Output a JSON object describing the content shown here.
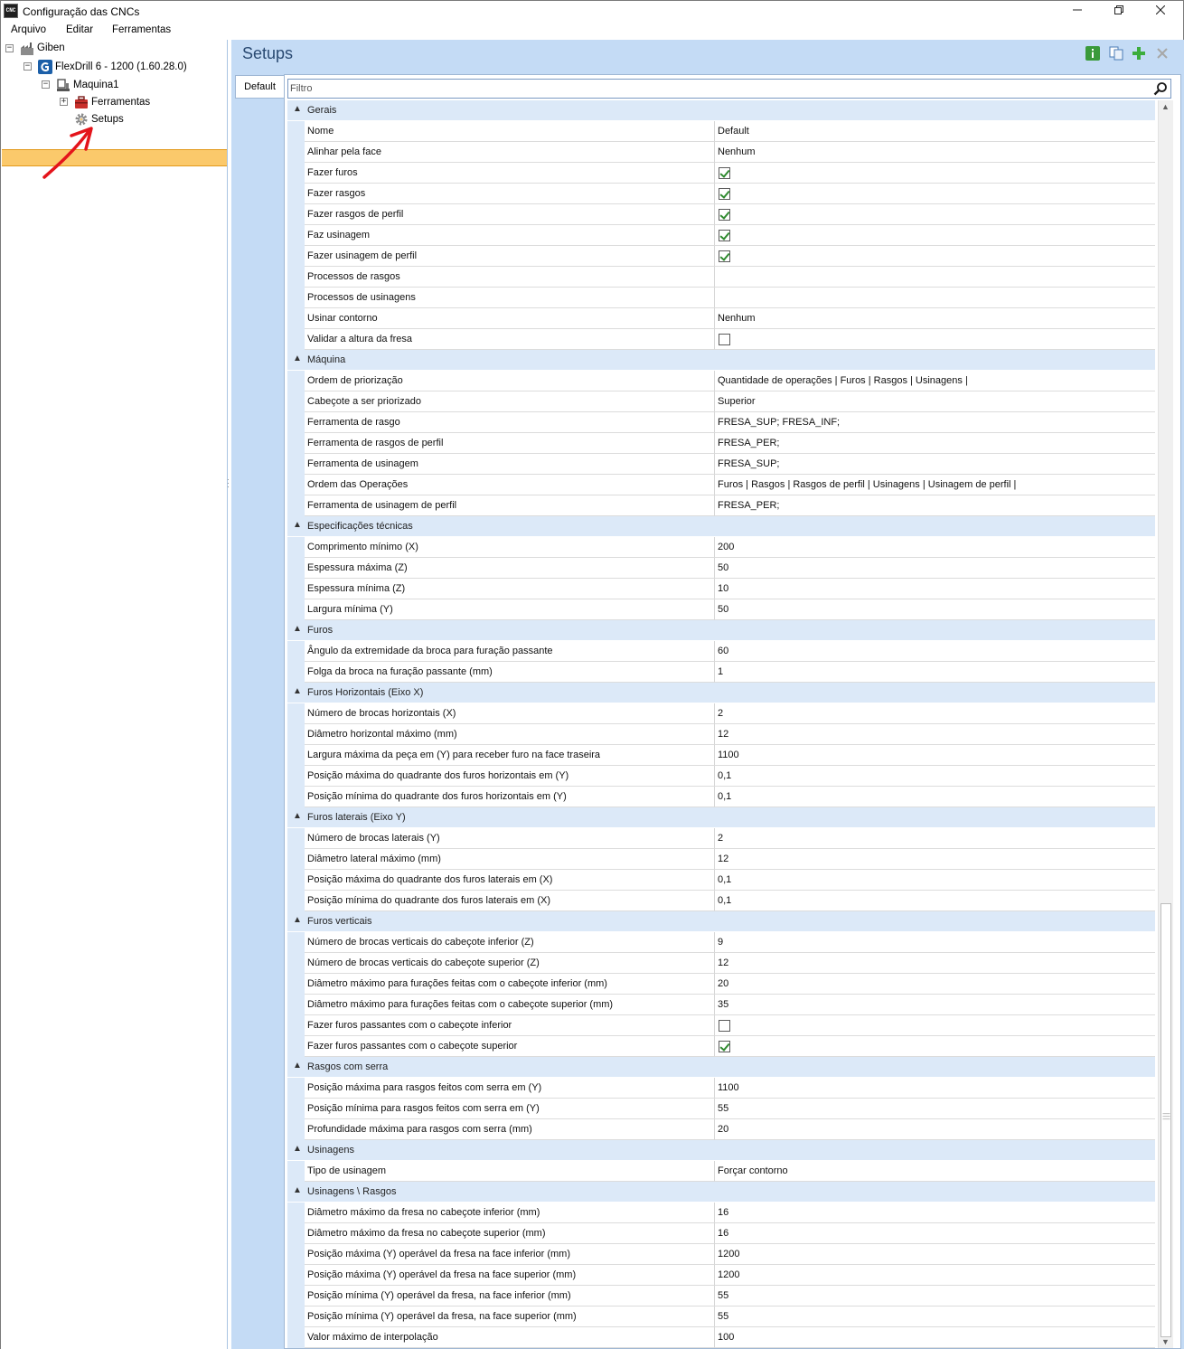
{
  "window": {
    "title": "Configuração das CNCs",
    "app_icon": "CNC"
  },
  "menu": [
    "Arquivo",
    "Editar",
    "Ferramentas"
  ],
  "tree": {
    "root": "Giben",
    "machine_model": "FlexDrill 6 - 1200 (1.60.28.0)",
    "machine": "Maquina1",
    "tools": "Ferramentas",
    "setups": "Setups"
  },
  "panel": {
    "title": "Setups",
    "tab": "Default",
    "filter_placeholder": "Filtro"
  },
  "colors": {
    "accent": "#2a4a72",
    "selection": "#fbc96b",
    "panel_bg": "#c4dbf5",
    "category_bg": "#dce9f8"
  },
  "grid": {
    "categories": [
      {
        "name": "Gerais",
        "rows": [
          {
            "name": "Nome",
            "value": "Default"
          },
          {
            "name": "Alinhar pela face",
            "value": "Nenhum"
          },
          {
            "name": "Fazer furos",
            "check": true
          },
          {
            "name": "Fazer rasgos",
            "check": true
          },
          {
            "name": "Fazer rasgos de perfil",
            "check": true
          },
          {
            "name": "Faz usinagem",
            "check": true
          },
          {
            "name": "Fazer usinagem de perfil",
            "check": true
          },
          {
            "name": "Processos de rasgos",
            "value": ""
          },
          {
            "name": "Processos de usinagens",
            "value": ""
          },
          {
            "name": "Usinar contorno",
            "value": "Nenhum"
          },
          {
            "name": "Validar a altura da fresa",
            "check": false
          }
        ]
      },
      {
        "name": "Máquina",
        "rows": [
          {
            "name": "Ordem de priorização",
            "value": "Quantidade de operações | Furos | Rasgos | Usinagens |"
          },
          {
            "name": "Cabeçote a ser priorizado",
            "value": "Superior"
          },
          {
            "name": "Ferramenta de rasgo",
            "value": "FRESA_SUP; FRESA_INF;"
          },
          {
            "name": "Ferramenta de rasgos de perfil",
            "value": "FRESA_PER;"
          },
          {
            "name": "Ferramenta de usinagem",
            "value": "FRESA_SUP;"
          },
          {
            "name": "Ordem das Operações",
            "value": "Furos | Rasgos | Rasgos de perfil | Usinagens | Usinagem de perfil |"
          },
          {
            "name": "Ferramenta de usinagem de perfil",
            "value": "FRESA_PER;"
          }
        ]
      },
      {
        "name": "Especificações técnicas",
        "rows": [
          {
            "name": "Comprimento mínimo (X)",
            "value": "200"
          },
          {
            "name": "Espessura máxima (Z)",
            "value": "50"
          },
          {
            "name": "Espessura mínima (Z)",
            "value": "10"
          },
          {
            "name": "Largura mínima (Y)",
            "value": "50"
          }
        ]
      },
      {
        "name": "Furos",
        "rows": [
          {
            "name": "Ângulo da extremidade da broca para furação passante",
            "value": "60"
          },
          {
            "name": "Folga da broca na furação passante (mm)",
            "value": "1"
          }
        ]
      },
      {
        "name": "Furos Horizontais (Eixo X)",
        "rows": [
          {
            "name": "Número de brocas horizontais (X)",
            "value": "2"
          },
          {
            "name": "Diâmetro horizontal máximo (mm)",
            "value": "12"
          },
          {
            "name": "Largura máxima da peça em (Y) para receber furo na face traseira",
            "value": "1100"
          },
          {
            "name": "Posição máxima do quadrante dos furos horizontais em (Y)",
            "value": "0,1"
          },
          {
            "name": "Posição mínima do quadrante dos furos horizontais em (Y)",
            "value": "0,1"
          }
        ]
      },
      {
        "name": "Furos laterais (Eixo Y)",
        "rows": [
          {
            "name": "Número de brocas laterais (Y)",
            "value": "2"
          },
          {
            "name": "Diâmetro lateral máximo (mm)",
            "value": "12"
          },
          {
            "name": "Posição máxima do quadrante dos furos laterais em (X)",
            "value": "0,1"
          },
          {
            "name": "Posição mínima do quadrante dos furos laterais em (X)",
            "value": "0,1"
          }
        ]
      },
      {
        "name": "Furos verticais",
        "rows": [
          {
            "name": "Número de brocas verticais do cabeçote inferior (Z)",
            "value": "9"
          },
          {
            "name": "Número de brocas verticais do cabeçote superior (Z)",
            "value": "12"
          },
          {
            "name": "Diâmetro máximo para furações feitas com o cabeçote inferior (mm)",
            "value": "20"
          },
          {
            "name": "Diâmetro máximo para furações feitas com o cabeçote superior (mm)",
            "value": "35"
          },
          {
            "name": "Fazer furos passantes com o cabeçote inferior",
            "check": false
          },
          {
            "name": "Fazer furos passantes com o cabeçote superior",
            "check": true
          }
        ]
      },
      {
        "name": "Rasgos com serra",
        "rows": [
          {
            "name": "Posição máxima para rasgos feitos com serra em (Y)",
            "value": "1100"
          },
          {
            "name": "Posição mínima para rasgos feitos com serra em (Y)",
            "value": "55"
          },
          {
            "name": "Profundidade máxima para rasgos com serra (mm)",
            "value": "20"
          }
        ]
      },
      {
        "name": "Usinagens",
        "rows": [
          {
            "name": "Tipo de usinagem",
            "value": "Forçar contorno"
          }
        ]
      },
      {
        "name": "Usinagens \\ Rasgos",
        "rows": [
          {
            "name": "Diâmetro máximo da fresa no cabeçote inferior (mm)",
            "value": "16"
          },
          {
            "name": "Diâmetro máximo da fresa no cabeçote superior (mm)",
            "value": "16"
          },
          {
            "name": "Posição máxima (Y) operável da fresa na face inferior (mm)",
            "value": "1200"
          },
          {
            "name": "Posição máxima (Y) operável da fresa na face superior (mm)",
            "value": "1200"
          },
          {
            "name": "Posição mínima (Y) operável da fresa, na face inferior (mm)",
            "value": "55"
          },
          {
            "name": "Posição mínima (Y) operável da fresa, na face superior (mm)",
            "value": "55"
          },
          {
            "name": "Valor máximo de interpolação",
            "value": "100"
          }
        ]
      }
    ]
  }
}
